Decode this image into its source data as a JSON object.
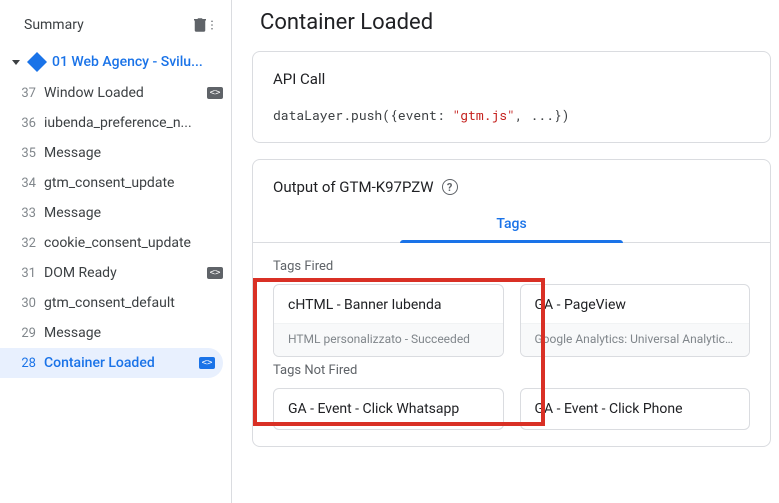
{
  "sidebar": {
    "summary_label": "Summary",
    "container_name": "01 Web Agency - Svilu...",
    "events": [
      {
        "num": "37",
        "name": "Window Loaded",
        "chip": true
      },
      {
        "num": "36",
        "name": "iubenda_preference_n...",
        "chip": false
      },
      {
        "num": "35",
        "name": "Message",
        "chip": false
      },
      {
        "num": "34",
        "name": "gtm_consent_update",
        "chip": false
      },
      {
        "num": "33",
        "name": "Message",
        "chip": false
      },
      {
        "num": "32",
        "name": "cookie_consent_update",
        "chip": false
      },
      {
        "num": "31",
        "name": "DOM Ready",
        "chip": true
      },
      {
        "num": "30",
        "name": "gtm_consent_default",
        "chip": false
      },
      {
        "num": "29",
        "name": "Message",
        "chip": false
      },
      {
        "num": "28",
        "name": "Container Loaded",
        "chip": true
      }
    ]
  },
  "main": {
    "title": "Container Loaded",
    "api": {
      "title": "API Call",
      "code_prefix": "dataLayer.push({event: ",
      "code_str": "\"gtm.js\"",
      "code_suffix": ", ...})"
    },
    "output": {
      "title": "Output of GTM-K97PZW",
      "tab": "Tags",
      "fired_label": "Tags Fired",
      "fired": [
        {
          "title": "cHTML - Banner Iubenda",
          "sub": "HTML personalizzato - Succeeded"
        },
        {
          "title": "GA - PageView",
          "sub": "Google Analytics: Universal Analytics - Succe"
        }
      ],
      "not_fired_label": "Tags Not Fired",
      "not_fired": [
        {
          "title": "GA - Event - Click Whatsapp"
        },
        {
          "title": "GA - Event - Click Phone"
        }
      ]
    }
  }
}
